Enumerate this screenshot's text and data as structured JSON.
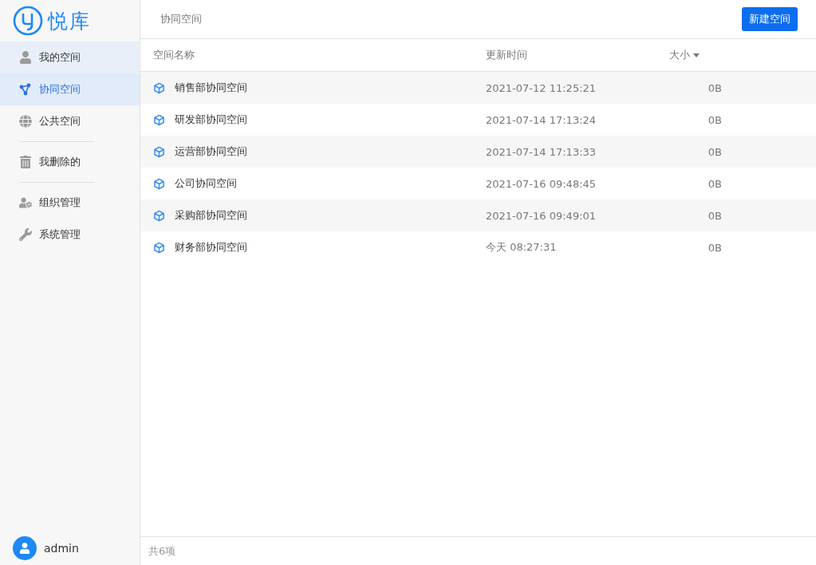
{
  "logo": {
    "text": "悦库"
  },
  "sidebar": {
    "groups": [
      {
        "items": [
          {
            "label": "我的空间",
            "selected": false,
            "hovered": true
          },
          {
            "label": "协同空间",
            "selected": true,
            "hovered": false
          },
          {
            "label": "公共空间",
            "selected": false,
            "hovered": false
          }
        ]
      },
      {
        "items": [
          {
            "label": "我删除的",
            "selected": false,
            "hovered": false
          }
        ]
      },
      {
        "items": [
          {
            "label": "组织管理",
            "selected": false,
            "hovered": false
          },
          {
            "label": "系统管理",
            "selected": false,
            "hovered": false
          }
        ]
      }
    ],
    "user": {
      "name": "admin"
    }
  },
  "header": {
    "breadcrumb": "协同空间",
    "button": "新建空间"
  },
  "table": {
    "columns": [
      {
        "label": "空间名称",
        "sorted": false
      },
      {
        "label": "更新时间",
        "sorted": false
      },
      {
        "label": "大小",
        "sorted": true
      }
    ],
    "rows": [
      {
        "name": "销售部协同空间",
        "updated": "2021-07-12 11:25:21",
        "size": "0B"
      },
      {
        "name": "研发部协同空间",
        "updated": "2021-07-14 17:13:24",
        "size": "0B"
      },
      {
        "name": "运营部协同空间",
        "updated": "2021-07-14 17:13:33",
        "size": "0B"
      },
      {
        "name": "公司协同空间",
        "updated": "2021-07-16 09:48:45",
        "size": "0B"
      },
      {
        "name": "采购部协同空间",
        "updated": "2021-07-16 09:49:01",
        "size": "0B"
      },
      {
        "name": "财务部协同空间",
        "updated": "今天 08:27:31",
        "size": "0B"
      }
    ]
  },
  "status_bar": {
    "count": "共6项"
  }
}
